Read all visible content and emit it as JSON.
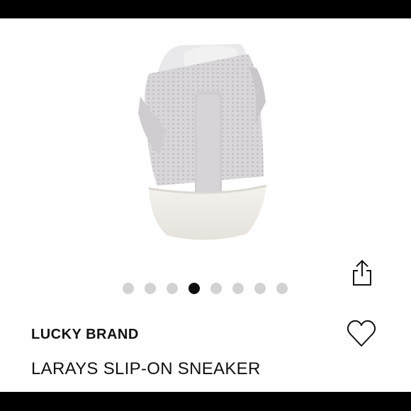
{
  "product": {
    "brand": "LUCKY BRAND",
    "title": "LARAYS SLIP-ON SNEAKER",
    "image_alt_icon": "sneaker-back-view"
  },
  "carousel": {
    "total": 8,
    "active_index": 3
  },
  "icons": {
    "share": "share-icon",
    "favorite": "heart-outline-icon"
  },
  "colors": {
    "background": "#ffffff",
    "dot_inactive": "#d2d2d2",
    "dot_active": "#0d0d0d",
    "text": "#111111",
    "shoe_upper": "#d7d5d8",
    "shoe_sole": "#efece6"
  }
}
